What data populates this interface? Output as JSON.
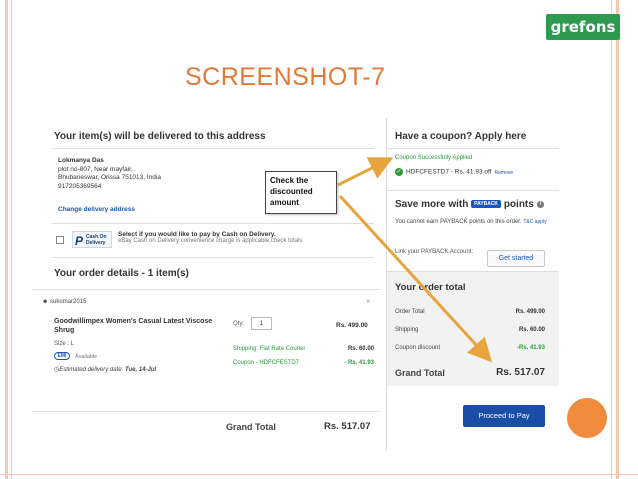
{
  "brand": {
    "logo_text": "grefons",
    "logo_color": "#2e9a4f"
  },
  "slide": {
    "title": "SCREENSHOT-7",
    "title_color": "#e2773a"
  },
  "delivery": {
    "heading": "Your item(s) will be delivered to this address",
    "name": "Lokmanya Das",
    "line1": "plot no-807,  Near mayfair,",
    "line2": "Bhubaneswar,  Orissa 751013,  India",
    "phone": "917205369564",
    "change_link": "Change delivery address"
  },
  "cod": {
    "logo_p": "P",
    "logo_text": "Cash On Delivery",
    "question": "Select if you would like to pay by Cash on Delivery.",
    "note": "eBay Cash on Delivery convenience charge is applicable,check totals"
  },
  "order": {
    "heading": "Your order details - 1 item(s)",
    "seller": "sukumar2015",
    "remove_x": "×",
    "product_name": "Goodwillimpex Women's Casual Latest Viscose Shrug",
    "qty_label": "Qty:",
    "qty_value": "1",
    "price": "Rs. 499.00",
    "size": "Size : L",
    "emi_badge": "EMI",
    "emi_text": "Available",
    "est_label": "Estimated delivery date:",
    "est_date": "Tue, 14-Jul",
    "shipping_label": "Shipping: Flat Rate Courier",
    "shipping_value": "Rs. 60.00",
    "coupon_label": "Coupon - HDFCFESTD7",
    "coupon_value": "- Rs. 41.93",
    "grand_label": "Grand Total",
    "grand_value": "Rs. 517.07"
  },
  "coupon": {
    "heading": "Have a coupon? Apply here",
    "success": "Coupon Successfully Applied",
    "code_text": "HDFCFESTD7 - Rs. 41.93 off",
    "remove": "Remove"
  },
  "payback": {
    "save_prefix": "Save more with",
    "badge": "PAYBACK",
    "save_suffix": "points",
    "cannot_text": "You cannot earn PAYBACK points on this order.",
    "tc": "T&C apply",
    "link_label": "Link your PAYBACK Account:",
    "get_started": "Get started"
  },
  "order_total": {
    "heading": "Your order total",
    "rows": [
      {
        "label": "Order Total",
        "value": "Rs. 499.00"
      },
      {
        "label": "Shipping",
        "value": "Rs. 60.00"
      },
      {
        "label": "Coupon discount",
        "value": "-Rs. 41.93"
      }
    ],
    "grand_label": "Grand Total",
    "grand_value": "Rs. 517.07",
    "pay_button": "Proceed to Pay"
  },
  "annotation": {
    "line1": "Check the",
    "line2": "discounted",
    "line3": "amount",
    "arrow_color": "#e8a33d"
  },
  "colors": {
    "accent_orange": "#f08a3c",
    "frame": "#f4c9b4",
    "link_blue": "#1a56b3",
    "success_green": "#2d9a3b",
    "pay_blue": "#1a4da6"
  }
}
